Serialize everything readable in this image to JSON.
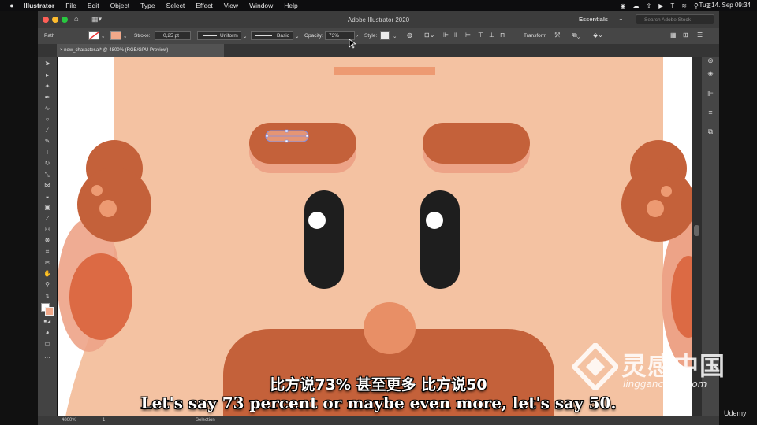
{
  "menubar": {
    "app": "Illustrator",
    "items": [
      "File",
      "Edit",
      "Object",
      "Type",
      "Select",
      "Effect",
      "View",
      "Window",
      "Help"
    ],
    "clock": "Tue 14. Sep 09:34"
  },
  "window": {
    "title": "Adobe Illustrator 2020",
    "workspace": "Essentials",
    "search_placeholder": "Search Adobe Stock"
  },
  "control_bar": {
    "selection_label": "Path",
    "stroke_label": "Stroke:",
    "stroke_value": "0,25 pt",
    "profile_value": "Uniform",
    "brush_value": "Basic",
    "opacity_label": "Opacity:",
    "opacity_value": "73%",
    "style_label": "Style:",
    "transform_label": "Transform"
  },
  "document_tab": {
    "label": "new_character.ai* @ 4800% (RGB/GPU Preview)"
  },
  "status_bar": {
    "zoom": "4800%",
    "artboard": "1",
    "tool": "Selection"
  },
  "subtitles": {
    "chinese": "比方说73% 甚至更多 比方说50",
    "english": "Let's say 73 percent or maybe even more, let's say 50."
  },
  "watermark": {
    "main": "灵感中国",
    "sub": "lingganchina.com",
    "badge": "Udemy"
  },
  "colors": {
    "skin": "#f4c2a2",
    "hair": "#c4613a",
    "shadow": "#eda387",
    "eye": "#1e1e1e",
    "nose": "#e88f66",
    "cheek": "#e07550"
  }
}
